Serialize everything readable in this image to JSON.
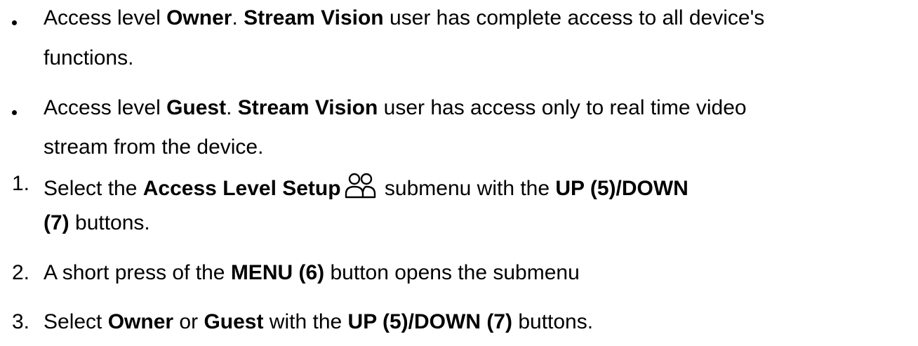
{
  "bullets": [
    {
      "line1": {
        "t1": "Access level ",
        "b1": "Owner",
        "t2": ". ",
        "b2": "Stream Vision",
        "t3": " user has complete access to all device's"
      },
      "line2": "functions."
    },
    {
      "line1": {
        "t1": "Access level ",
        "b1": "Guest",
        "t2": ". ",
        "b2": "Stream Vision",
        "t3": " user has access only to real time video"
      },
      "line2": "stream from the device."
    }
  ],
  "steps": [
    {
      "number": "1.",
      "line1": {
        "t1": "Select the ",
        "b1": "Access Level Setup",
        "icon": "users-icon",
        "t2": " submenu with the ",
        "b2": "UP (5)/DOWN"
      },
      "line2": {
        "b1": "(7)",
        "t1": " buttons."
      }
    },
    {
      "number": "2.",
      "line1": {
        "t1": "A short press of the ",
        "b1": "MENU (6)",
        "t2": " button opens the submenu"
      }
    },
    {
      "number": "3.",
      "line1": {
        "t1": "Select ",
        "b1": "Owner",
        "t2": " or ",
        "b2": "Guest",
        "t3": " with the ",
        "b3": "UP (5)/DOWN (7)",
        "t4": " buttons."
      }
    }
  ]
}
